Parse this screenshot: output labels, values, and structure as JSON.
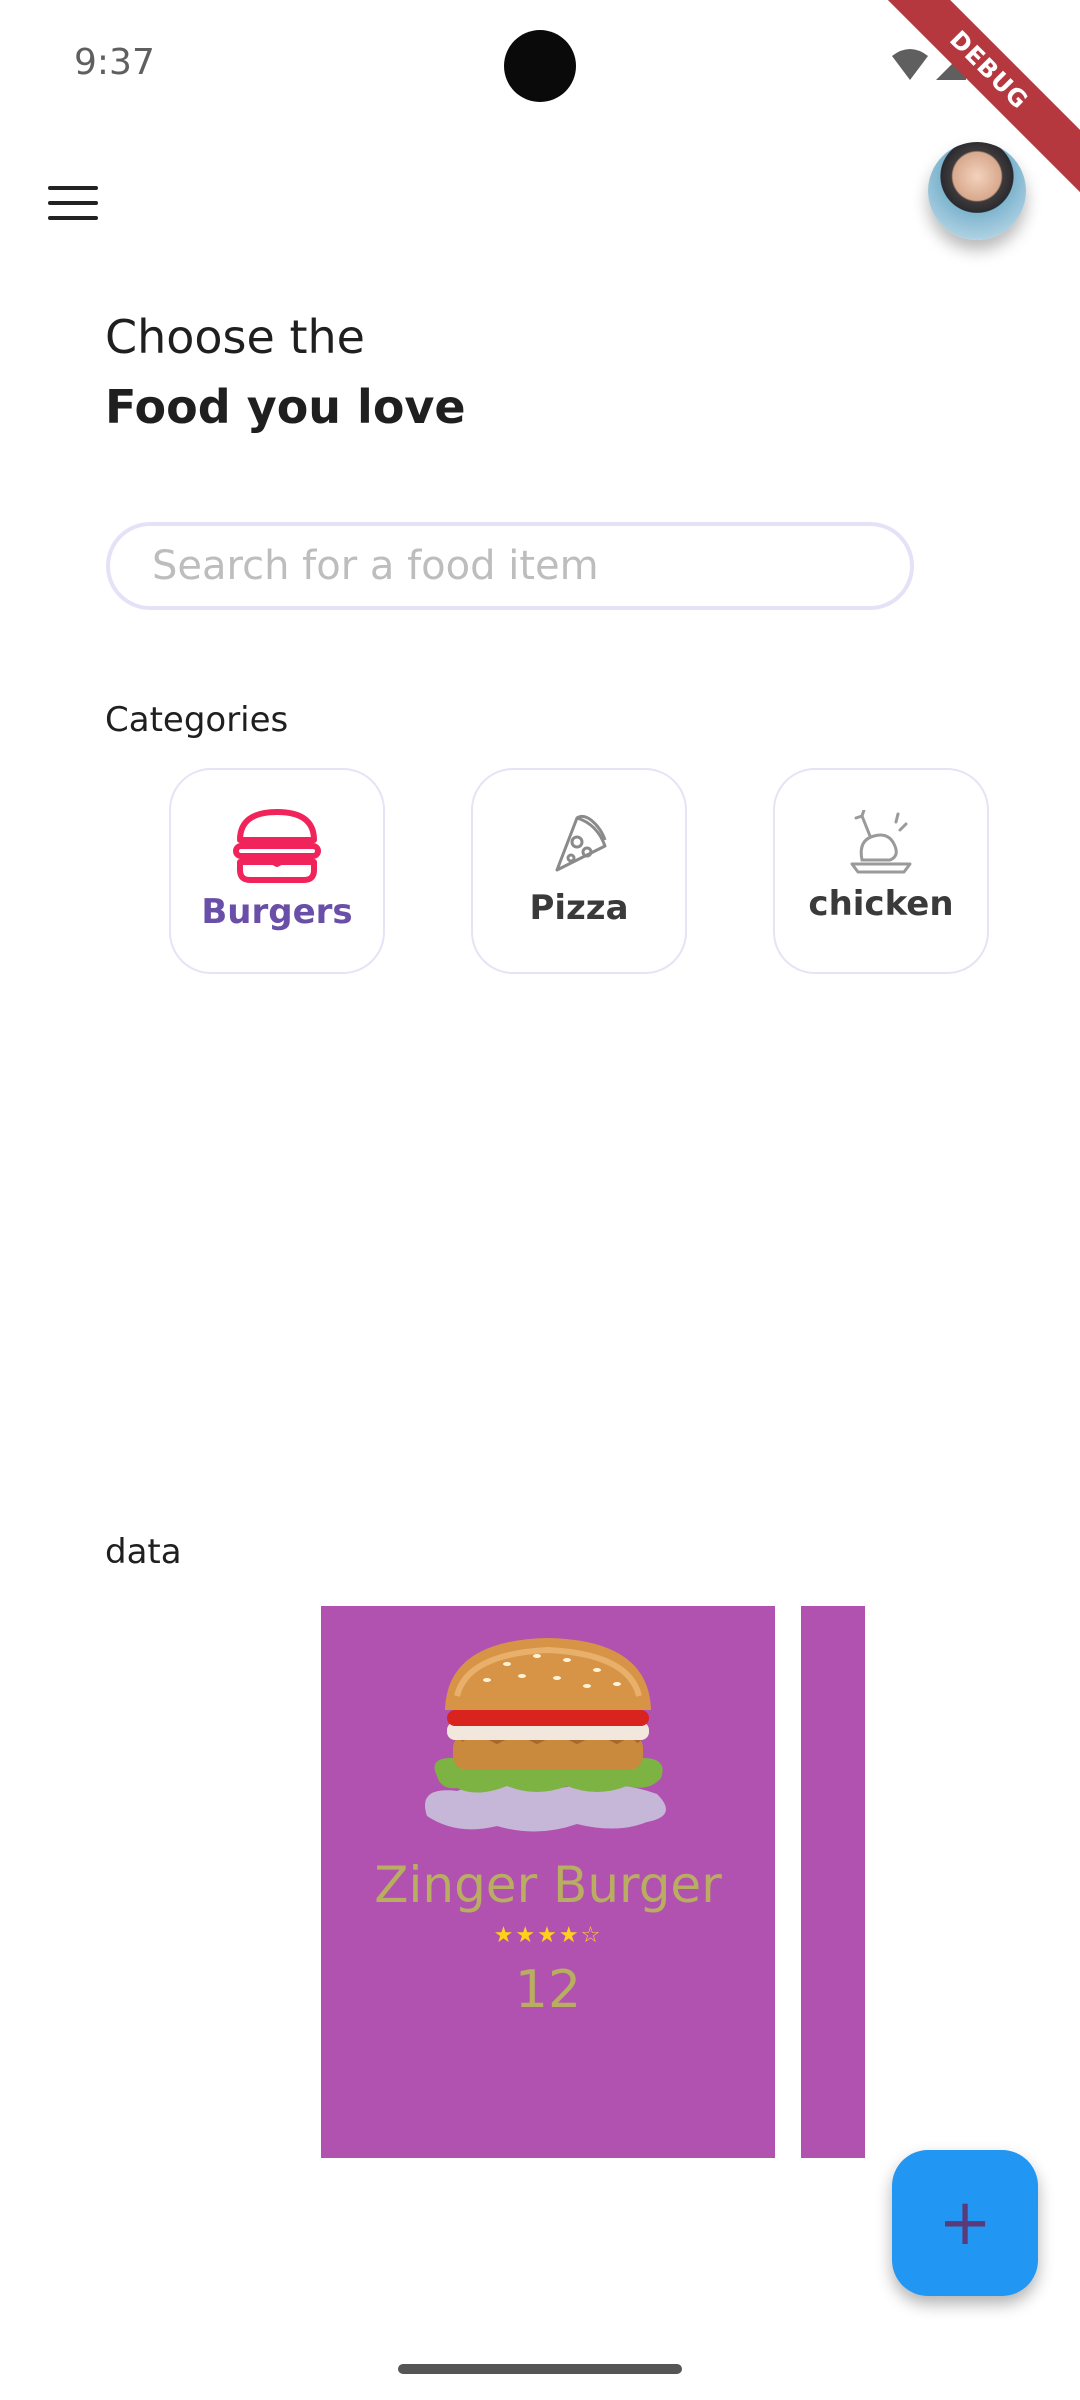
{
  "status_bar": {
    "time": "9:37"
  },
  "debug_banner": {
    "label": "DEBUG"
  },
  "header": {
    "line1": "Choose the",
    "line2": "Food you love"
  },
  "search": {
    "placeholder": "Search for a food item",
    "value": ""
  },
  "categories": {
    "title": "Categories",
    "items": [
      {
        "label": "Burgers",
        "icon": "burger-icon",
        "selected": true,
        "color": "#6a4fa8",
        "icon_color": "#f0245a"
      },
      {
        "label": "Pizza",
        "icon": "pizza-icon",
        "selected": false,
        "color": "#3a3a3a"
      },
      {
        "label": "chicken",
        "icon": "chicken-icon",
        "selected": false,
        "color": "#3a3a3a"
      }
    ]
  },
  "data_section": {
    "title": "data",
    "items": [
      {
        "name": "Zinger Burger",
        "rating": 4,
        "rating_max": 5,
        "price": "12",
        "card_color": "#b152b0",
        "text_color": "#b8ad60"
      }
    ]
  },
  "fab": {
    "icon": "plus-icon",
    "color": "#2196f3"
  }
}
